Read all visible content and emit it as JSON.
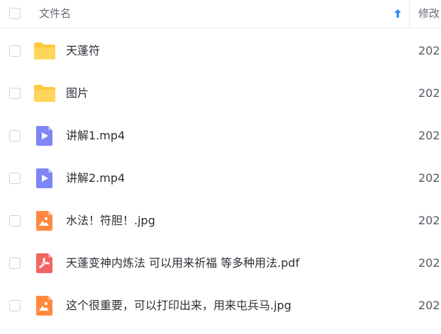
{
  "header": {
    "name_label": "文件名",
    "date_label": "修改",
    "sort_icon": "arrow-up-icon"
  },
  "files": [
    {
      "name": "天蓬符",
      "date": "202",
      "type": "folder",
      "icon": "folder-icon"
    },
    {
      "name": "图片",
      "date": "202",
      "type": "folder",
      "icon": "folder-icon"
    },
    {
      "name": "讲解1.mp4",
      "date": "202",
      "type": "video",
      "icon": "video-file-icon"
    },
    {
      "name": "讲解2.mp4",
      "date": "202",
      "type": "video",
      "icon": "video-file-icon"
    },
    {
      "name": "水法！符胆！.jpg",
      "date": "202",
      "type": "image",
      "icon": "image-file-icon"
    },
    {
      "name": "天蓬变神内炼法 可以用来祈福 等多种用法.pdf",
      "date": "202",
      "type": "pdf",
      "icon": "pdf-file-icon"
    },
    {
      "name": "这个很重要，可以打印出来，用来屯兵马.jpg",
      "date": "202",
      "type": "image",
      "icon": "image-file-icon"
    }
  ],
  "colors": {
    "folder": "#ffc93d",
    "video": "#7f86f6",
    "image": "#ff8a3d",
    "pdf": "#f26464",
    "sort_arrow": "#1a86f0"
  }
}
